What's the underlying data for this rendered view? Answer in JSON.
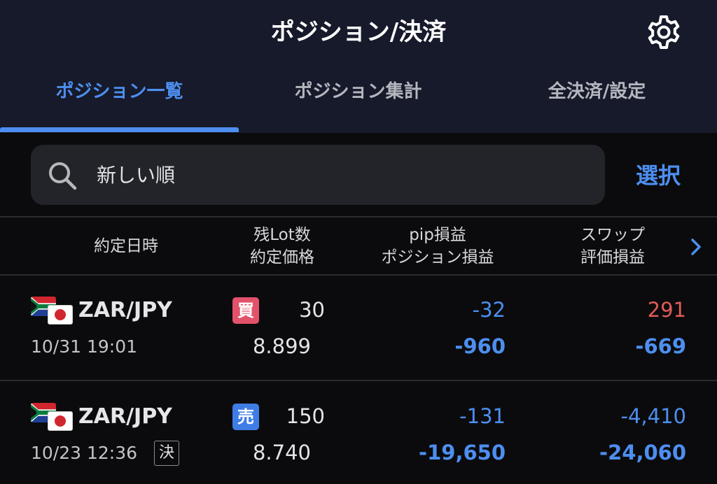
{
  "header": {
    "title": "ポジション/決済",
    "settings_icon": "gear-icon"
  },
  "tabs": [
    {
      "label": "ポジション一覧",
      "active": true
    },
    {
      "label": "ポジション集計",
      "active": false
    },
    {
      "label": "全決済/設定",
      "active": false
    }
  ],
  "search": {
    "sort_label": "新しい順",
    "select_label": "選択"
  },
  "columns": {
    "col1": "約定日時",
    "col2_line1": "残Lot数",
    "col2_line2": "約定価格",
    "col3_line1": "pip損益",
    "col3_line2": "ポジション損益",
    "col4_line1": "スワップ",
    "col4_line2": "評価損益"
  },
  "positions": [
    {
      "pair": "ZAR/JPY",
      "datetime": "10/31 19:01",
      "side": "買",
      "lots": "30",
      "price": "8.899",
      "pip_pl": "-32",
      "position_pl": "-960",
      "swap": "291",
      "valuation_pl": "-669",
      "settle_mark": ""
    },
    {
      "pair": "ZAR/JPY",
      "datetime": "10/23 12:36",
      "side": "売",
      "lots": "150",
      "price": "8.740",
      "pip_pl": "-131",
      "position_pl": "-19,650",
      "swap": "-4,410",
      "valuation_pl": "-24,060",
      "settle_mark": "決"
    }
  ],
  "colors": {
    "accent": "#4d8ff0",
    "buy": "#e2526a",
    "sell": "#3f7de6",
    "positive": "#e05a57",
    "header_bg": "#161a2a"
  }
}
